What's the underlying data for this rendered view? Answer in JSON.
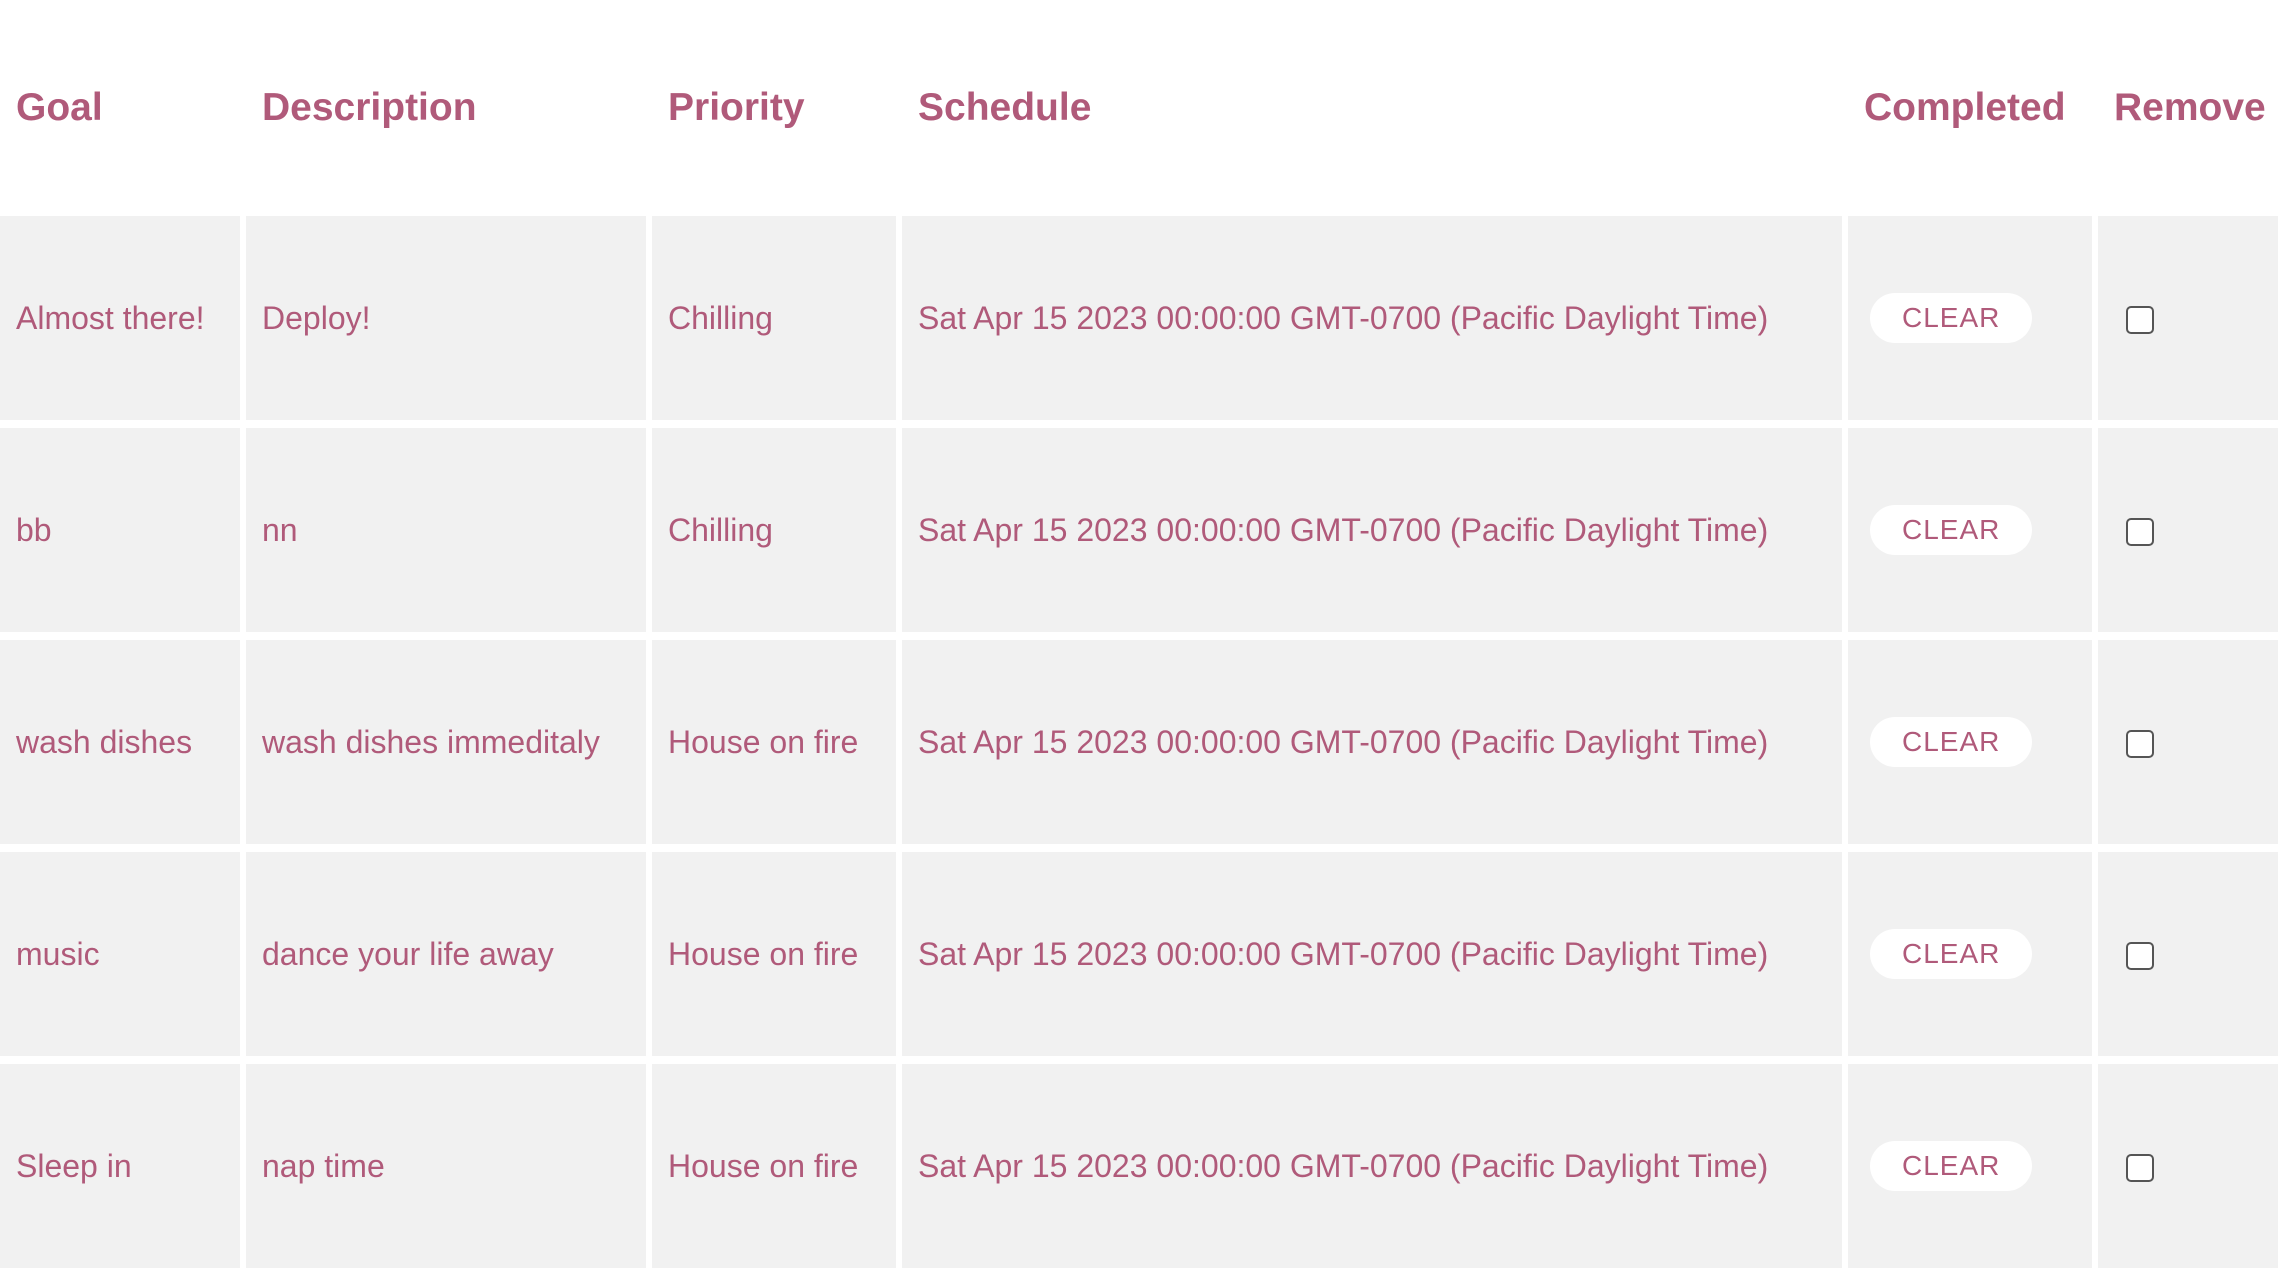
{
  "table": {
    "headers": {
      "goal": "Goal",
      "description": "Description",
      "priority": "Priority",
      "schedule": "Schedule",
      "completed": "Completed",
      "remove": "Remove"
    },
    "clear_label": "CLEAR",
    "rows": [
      {
        "goal": "Almost there!",
        "description": "Deploy!",
        "priority": "Chilling",
        "schedule": "Sat Apr 15 2023 00:00:00 GMT-0700 (Pacific Daylight Time)"
      },
      {
        "goal": "bb",
        "description": "nn",
        "priority": "Chilling",
        "schedule": "Sat Apr 15 2023 00:00:00 GMT-0700 (Pacific Daylight Time)"
      },
      {
        "goal": "wash dishes",
        "description": "wash dishes immeditaly",
        "priority": "House on fire",
        "schedule": "Sat Apr 15 2023 00:00:00 GMT-0700 (Pacific Daylight Time)"
      },
      {
        "goal": "music",
        "description": "dance your life away",
        "priority": "House on fire",
        "schedule": "Sat Apr 15 2023 00:00:00 GMT-0700 (Pacific Daylight Time)"
      },
      {
        "goal": "Sleep in",
        "description": "nap time",
        "priority": "House on fire",
        "schedule": "Sat Apr 15 2023 00:00:00 GMT-0700 (Pacific Daylight Time)"
      }
    ]
  },
  "colors": {
    "text": "#b05a7a",
    "row_background": "#f1f1f1",
    "page_background": "#ffffff"
  }
}
